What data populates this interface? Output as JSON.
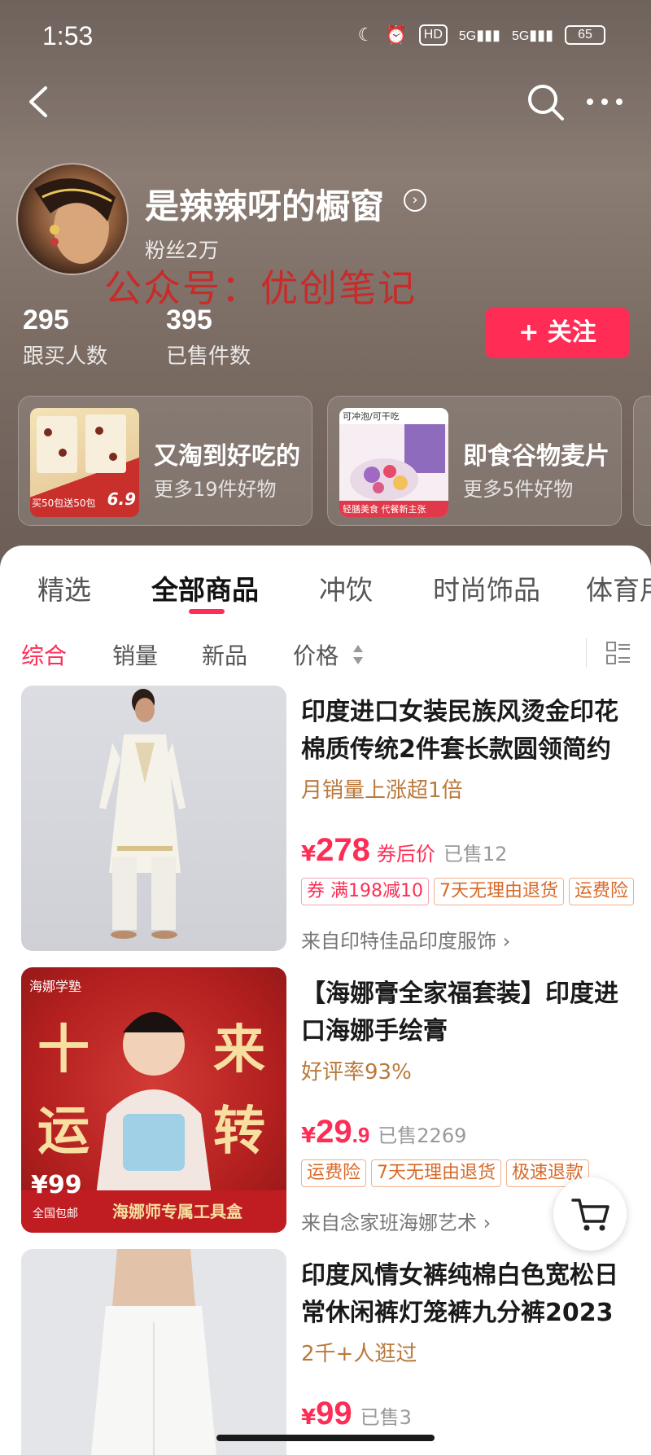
{
  "status_bar": {
    "time": "1:53",
    "hd": "HD",
    "net1": "5G",
    "net2": "5G",
    "battery": "65"
  },
  "profile": {
    "shop_name": "是辣辣呀的橱窗",
    "fans": "粉丝2万",
    "watermark": "公众号：优创笔记",
    "stats": [
      {
        "value": "295",
        "label": "跟买人数"
      },
      {
        "value": "395",
        "label": "已售件数"
      }
    ],
    "follow_label": "+ 关注"
  },
  "collections": [
    {
      "title": "又淘到好吃的",
      "subtitle": "更多19件好物",
      "thumb_text": "买50包送50包",
      "thumb_price": "6.9"
    },
    {
      "title": "即食谷物麦片",
      "subtitle": "更多5件好物",
      "thumb_text": "轻膳美食 代餐新主张",
      "thumb_top": "可冲泡/可干吃"
    }
  ],
  "tabs": [
    "精选",
    "全部商品",
    "冲饮",
    "时尚饰品",
    "体育用品"
  ],
  "filters": [
    "综合",
    "销量",
    "新品",
    "价格"
  ],
  "products": [
    {
      "title": "印度进口女装民族风烫金印花棉质传统2件套长款圆领简约",
      "note": "月销量上涨超1倍",
      "price_symbol": "¥",
      "price_int": "278",
      "price_dec": "",
      "price_after": "券后价",
      "sold": "已售12",
      "tags": [
        "券 满198减10",
        "7天无理由退货",
        "运费险"
      ],
      "store": "来自印特佳品印度服饰 ›"
    },
    {
      "title": "【海娜膏全家福套装】印度进口海娜手绘膏",
      "note": "好评率93%",
      "price_symbol": "¥",
      "price_int": "29",
      "price_dec": ".9",
      "price_after": "",
      "sold": "已售2269",
      "tags": [
        "运费险",
        "7天无理由退货",
        "极速退款"
      ],
      "store": "来自念家班海娜艺术 ›",
      "banner": {
        "brand": "海娜学塾",
        "c1": "十",
        "c2": "来",
        "c3": "运",
        "c4": "转",
        "price": "¥99",
        "price_note": "全国包邮",
        "box": "海娜师专属工具盒"
      }
    },
    {
      "title": "印度风情女裤纯棉白色宽松日常休闲裤灯笼裤九分裤2023",
      "note": "2千+人逛过",
      "price_symbol": "¥",
      "price_int": "99",
      "price_dec": "",
      "price_after": "",
      "sold": "已售3",
      "tags": [],
      "store": ""
    }
  ],
  "colors": {
    "accent": "#ff2d55",
    "note": "#b9793b",
    "tag": "#d86a2a"
  }
}
